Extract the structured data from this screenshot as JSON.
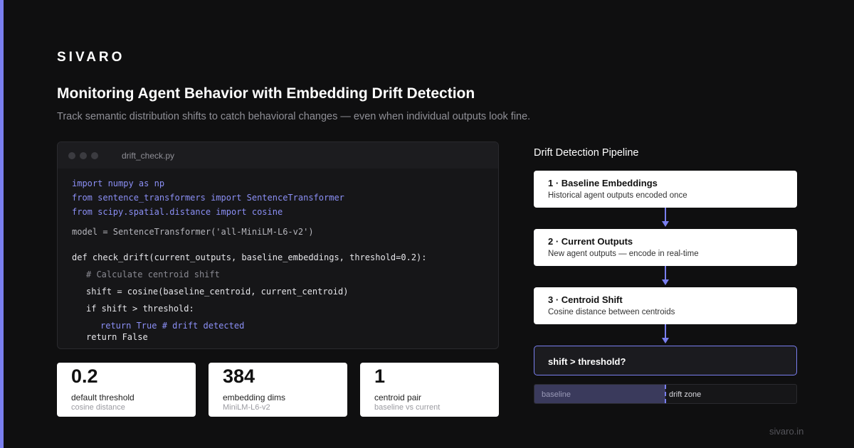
{
  "brand": "SIVARO",
  "title": "Monitoring Agent Behavior with Embedding Drift Detection",
  "subtitle": "Track semantic distribution shifts to catch behavioral changes — even when individual outputs look fine.",
  "code": {
    "filename": "drift_check.py",
    "lines": {
      "l1": "import numpy as np",
      "l2": "from sentence_transformers import SentenceTransformer",
      "l3": "from scipy.spatial.distance import cosine",
      "l4": "model = SentenceTransformer('all-MiniLM-L6-v2')",
      "l5": "def check_drift(current_outputs, baseline_embeddings, threshold=0.2):",
      "l6": "# Calculate centroid shift",
      "l7": "shift = cosine(baseline_centroid, current_centroid)",
      "l8": "if shift > threshold:",
      "l9": "return True # drift detected",
      "l10": "return False"
    }
  },
  "stats": [
    {
      "value": "0.2",
      "label": "default threshold",
      "sub": "cosine distance"
    },
    {
      "value": "384",
      "label": "embedding dims",
      "sub": "MiniLM-L6-v2"
    },
    {
      "value": "1",
      "label": "centroid pair",
      "sub": "baseline vs current"
    }
  ],
  "pipeline": {
    "title": "Drift Detection Pipeline",
    "steps": [
      {
        "title": "1 · Baseline Embeddings",
        "desc": "Historical agent outputs encoded once"
      },
      {
        "title": "2 · Current Outputs",
        "desc": "New agent outputs — encode in real-time"
      },
      {
        "title": "3 · Centroid Shift",
        "desc": "Cosine distance between centroids"
      }
    ],
    "decision": "shift > threshold?",
    "bar": {
      "baseline_label": "baseline",
      "drift_label": "drift zone",
      "baseline_fraction": 0.5
    }
  },
  "footer": "sivaro.in",
  "colors": {
    "accent": "#7a7ff0",
    "background": "#0f0f10",
    "card": "#ffffff"
  }
}
